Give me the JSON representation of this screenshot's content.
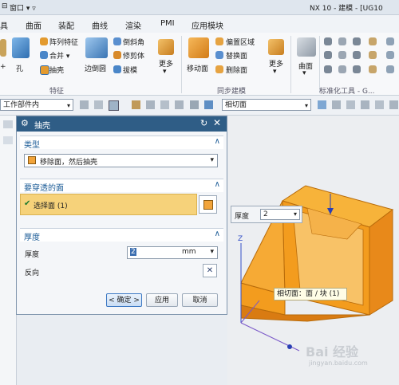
{
  "title_bar": {
    "window_menu": "窗口",
    "app_title": "NX 10 - 建模 - [UG10"
  },
  "menu": {
    "items": [
      "具",
      "曲面",
      "装配",
      "曲线",
      "渲染",
      "PMI",
      "应用模块"
    ]
  },
  "ribbon": {
    "hole": "孔",
    "pattern_feature": "阵列特征",
    "combine": "合并",
    "shell": "抽壳",
    "edge_blend": "边倒圆",
    "chamfer": "倒斜角",
    "trim_body": "修剪体",
    "draft": "拔模",
    "more1": "更多",
    "move_face": "移动面",
    "offset_region": "偏置区域",
    "replace_face": "替换面",
    "delete_face": "删除面",
    "more2": "更多",
    "surface": "曲面",
    "group_feature": "特征",
    "group_sync": "同步建模",
    "group_std": "标准化工具 - G..."
  },
  "toolbar2": {
    "scope": "工作部件内",
    "face_rule": "相切面"
  },
  "dialog": {
    "title": "抽壳",
    "type_header": "类型",
    "type_value": "移除面，然后抽壳",
    "pierce_header": "要穿透的面",
    "select_face": "选择面 (1)",
    "thickness_header": "厚度",
    "thickness_label": "厚度",
    "thickness_value": "2",
    "thickness_unit": "mm",
    "reverse_label": "反向",
    "ok": "< 确定 >",
    "apply": "应用",
    "cancel": "取消"
  },
  "graphics": {
    "thickness_label": "厚度",
    "thickness_value": "2",
    "tooltip": "相切面：面 / 块 (1)",
    "axis_z": "Z",
    "watermark": "Bai 经验",
    "watermark_url": "jingyan.baidu.com"
  },
  "colors": {
    "accent": "#1c5c97",
    "dialog_title": "#2f5d86",
    "selection_highlight": "#f6d27a",
    "part_orange": "#f5a623"
  }
}
